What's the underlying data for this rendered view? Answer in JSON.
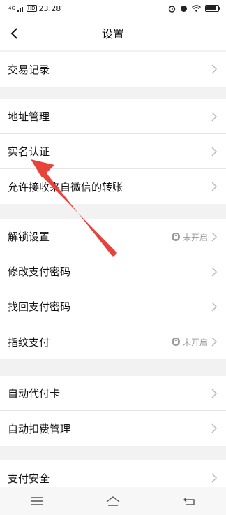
{
  "status_bar": {
    "network": "4G",
    "hd_badge": "HD",
    "time": "23:28"
  },
  "header": {
    "title": "设置"
  },
  "groups": [
    {
      "items": [
        {
          "label": "交易记录"
        }
      ]
    },
    {
      "items": [
        {
          "label": "地址管理"
        },
        {
          "label": "实名认证"
        },
        {
          "label": "允许接收来自微信的转账"
        }
      ]
    },
    {
      "items": [
        {
          "label": "解锁设置",
          "status": "未开启"
        },
        {
          "label": "修改支付密码"
        },
        {
          "label": "找回支付密码"
        },
        {
          "label": "指纹支付",
          "status": "未开启"
        }
      ]
    },
    {
      "items": [
        {
          "label": "自动代付卡"
        },
        {
          "label": "自动扣费管理"
        }
      ]
    },
    {
      "items": [
        {
          "label": "支付安全"
        }
      ]
    }
  ],
  "annotation": {
    "arrow_color": "#e8433b"
  },
  "nav_icons": [
    "menu-icon",
    "home-icon",
    "back-return-icon"
  ]
}
